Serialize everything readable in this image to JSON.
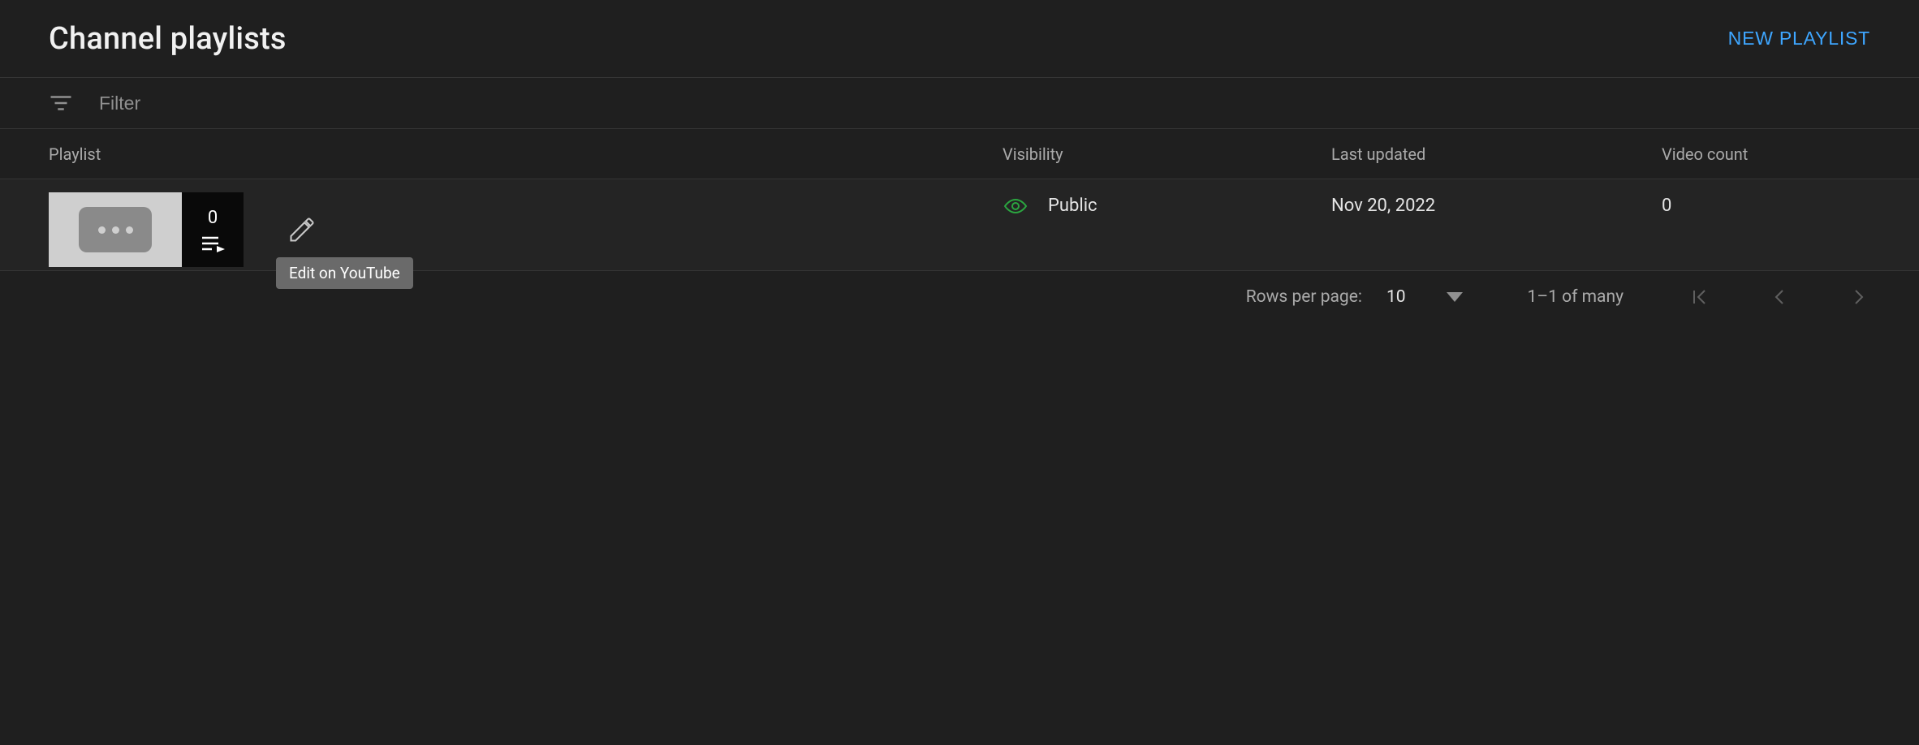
{
  "header": {
    "title": "Channel playlists",
    "new_playlist_label": "NEW PLAYLIST"
  },
  "filter": {
    "placeholder": "Filter"
  },
  "columns": {
    "playlist": "Playlist",
    "visibility": "Visibility",
    "last_updated": "Last updated",
    "video_count": "Video count"
  },
  "rows": [
    {
      "overlay_count": "0",
      "visibility": "Public",
      "last_updated": "Nov 20, 2022",
      "video_count": "0"
    }
  ],
  "tooltip": {
    "edit_on_youtube": "Edit on YouTube"
  },
  "pagination": {
    "rows_per_page_label": "Rows per page:",
    "rows_per_page_value": "10",
    "range_text": "1–1 of many"
  }
}
